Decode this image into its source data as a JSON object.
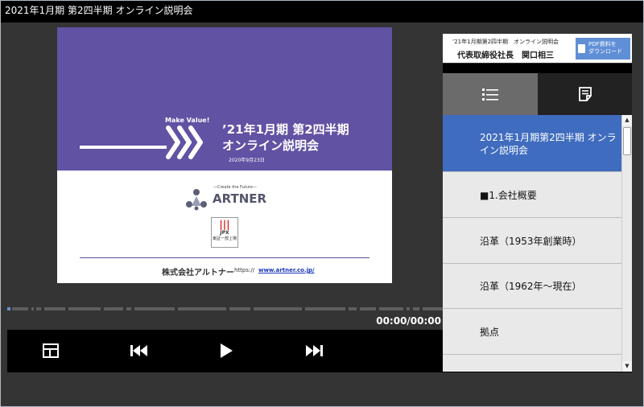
{
  "window": {
    "title": "2021年1月期 第2四半期 オンライン説明会"
  },
  "slide": {
    "make_value": "Make Value!",
    "title_line1": "’21年1月期 第2四半期",
    "title_line2": "オンライン説明会",
    "date": "2020年9月23日",
    "tagline": "—Create the Future—",
    "logo_text": "ARTNER",
    "jpx_top": "JPX",
    "jpx_bottom": "東証一部上場",
    "company": "株式会社アルトナー",
    "url_prefix": "https://",
    "url": "www.artner.co.jp/"
  },
  "player": {
    "time": "00:00/00:00",
    "controls": {
      "layout_icon": "layout-icon",
      "prev_icon": "skip-previous-icon",
      "play_icon": "play-icon",
      "next_icon": "skip-next-icon"
    }
  },
  "sidebar": {
    "header_line1": "’21年1月期第2四半期　オンライン説明会",
    "header_line2": "代表取締役社長　関口相三",
    "pdf_button_line1": "PDF資料を",
    "pdf_button_line2": "ダウンロード",
    "tabs": [
      {
        "icon": "list-icon"
      },
      {
        "icon": "notes-icon"
      }
    ],
    "items": [
      {
        "label_line1": "2021年1月期第2四半期 オンラ",
        "label_line2": "イン説明会"
      },
      {
        "label": "■1.会社概要"
      },
      {
        "label": "沿革（1953年創業時）"
      },
      {
        "label": "沿革（1962年～現在）"
      },
      {
        "label": "拠点"
      }
    ]
  },
  "colors": {
    "slide_purple": "#6152a3",
    "active_item": "#3f6cbe",
    "pdf_button": "#5f8fd6"
  }
}
